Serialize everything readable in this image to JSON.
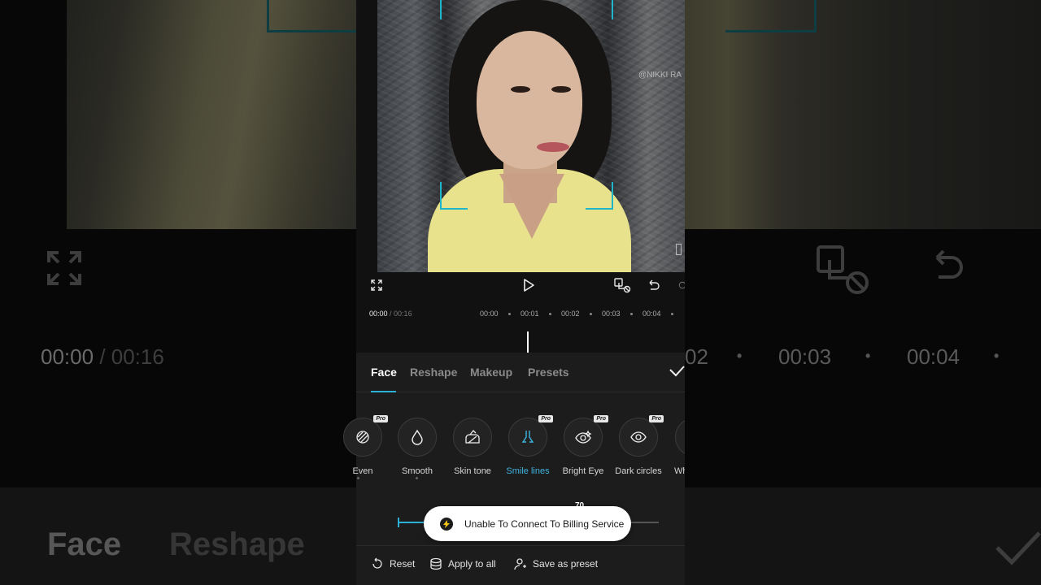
{
  "toolbar": {
    "fullscreen_icon": "expand-icon",
    "play_icon": "play-icon",
    "compare_icon": "compare-icon",
    "undo_icon": "undo-icon"
  },
  "preview": {
    "watermark": "@NIKKI RA"
  },
  "timeline": {
    "current_time": "00:00",
    "duration": "/ 00:16",
    "ticks": [
      "00:00",
      "00:01",
      "00:02",
      "00:03",
      "00:04"
    ]
  },
  "tabs": {
    "face": "Face",
    "reshape": "Reshape",
    "makeup": "Makeup",
    "presets": "Presets"
  },
  "tools": [
    {
      "label": "Even",
      "pro": "Pro"
    },
    {
      "label": "Smooth"
    },
    {
      "label": "Skin tone"
    },
    {
      "label": "Smile lines",
      "pro": "Pro"
    },
    {
      "label": "Bright Eye",
      "pro": "Pro"
    },
    {
      "label": "Dark circles",
      "pro": "Pro"
    },
    {
      "label": "Wh"
    }
  ],
  "slider": {
    "value_label": "70",
    "fraction": 0.7
  },
  "toast": {
    "message": "Unable To Connect To Billing Service"
  },
  "bottom_bar": {
    "reset": "Reset",
    "apply_all": "Apply to all",
    "save_preset": "Save as preset"
  },
  "background": {
    "time_current": "00:00",
    "time_duration": "/ 00:16",
    "tick_02": "02",
    "tick_03": "00:03",
    "tick_04": "00:04",
    "tab_face": "Face",
    "tab_reshape": "Reshape"
  },
  "colors": {
    "accent": "#2db0d6",
    "selected_label": "#3fb4e0",
    "face_bracket": "#1fb6c9"
  }
}
